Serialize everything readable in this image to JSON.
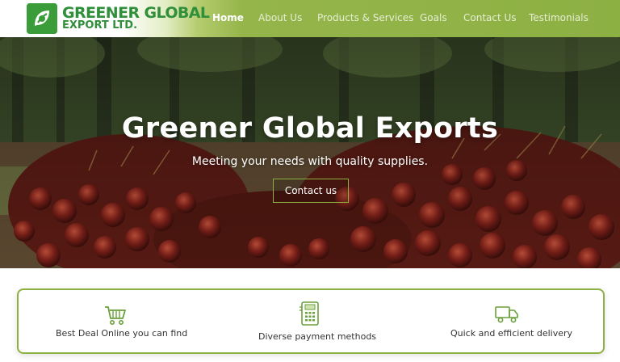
{
  "brand": {
    "name_line1": "GREENER GLOBAL",
    "name_line2": "EXPORT LTD.",
    "color": "#2f8f3a",
    "icon": "leaf-logo-icon"
  },
  "nav": {
    "items": [
      {
        "label": "Home",
        "active": true
      },
      {
        "label": "About Us"
      },
      {
        "label": "Products & Services"
      },
      {
        "label": "Goals"
      },
      {
        "label": "Contact Us"
      },
      {
        "label": "Testimonials"
      }
    ],
    "background": "#8db043"
  },
  "hero": {
    "title": "Greener Global Exports",
    "subtitle": "Meeting your needs with quality supplies.",
    "button_label": "Contact us",
    "accent": "#8db043"
  },
  "features": [
    {
      "label": "Best Deal Online you can find",
      "icon": "shopping-cart-icon"
    },
    {
      "label": "Diverse payment methods",
      "icon": "payment-terminal-icon"
    },
    {
      "label": "Quick and efficient delivery",
      "icon": "delivery-truck-icon"
    }
  ]
}
